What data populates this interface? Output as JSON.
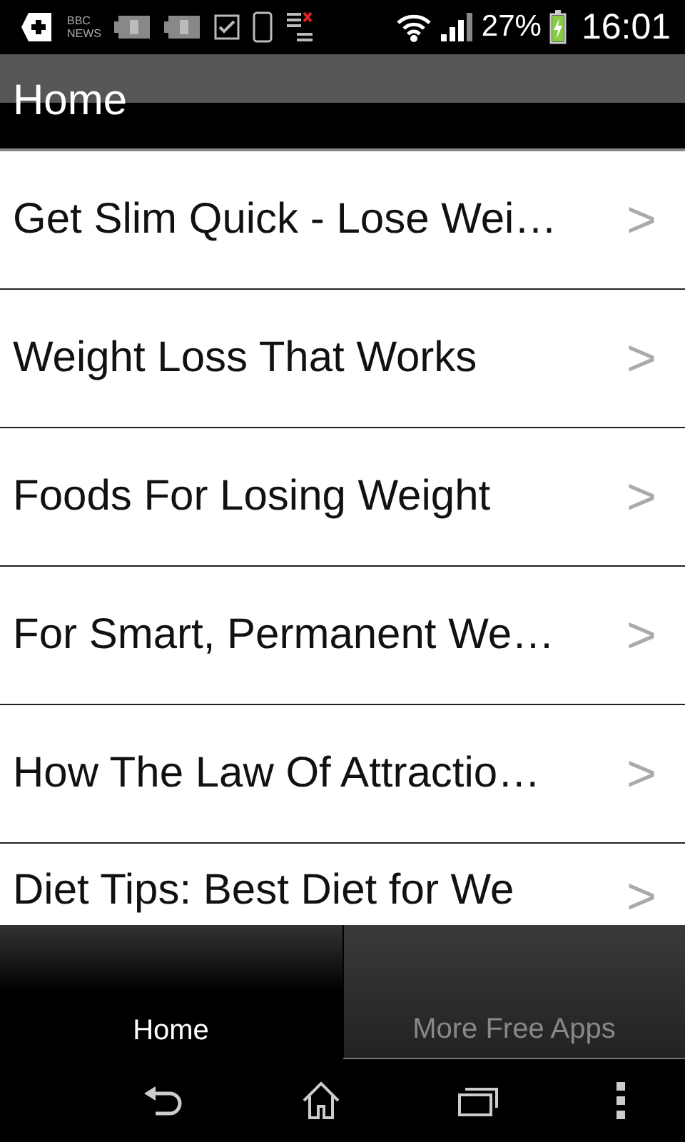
{
  "status_bar": {
    "notification_label_top": "BBC",
    "notification_label_bottom": "NEWS",
    "battery": "27%",
    "time": "16:01"
  },
  "header": {
    "title": "Home"
  },
  "articles": [
    {
      "title": "Get Slim Quick - Lose Wei…",
      "chevron": ">"
    },
    {
      "title": "Weight Loss That Works",
      "chevron": ">"
    },
    {
      "title": "Foods For Losing Weight",
      "chevron": ">"
    },
    {
      "title": "For Smart, Permanent We…",
      "chevron": ">"
    },
    {
      "title": "How The Law Of Attractio…",
      "chevron": ">"
    },
    {
      "title": "Diet Tips: Best Diet for We",
      "chevron": ">"
    }
  ],
  "tabs": [
    {
      "label": "Home",
      "selected": true
    },
    {
      "label": "More Free Apps",
      "selected": false
    }
  ]
}
